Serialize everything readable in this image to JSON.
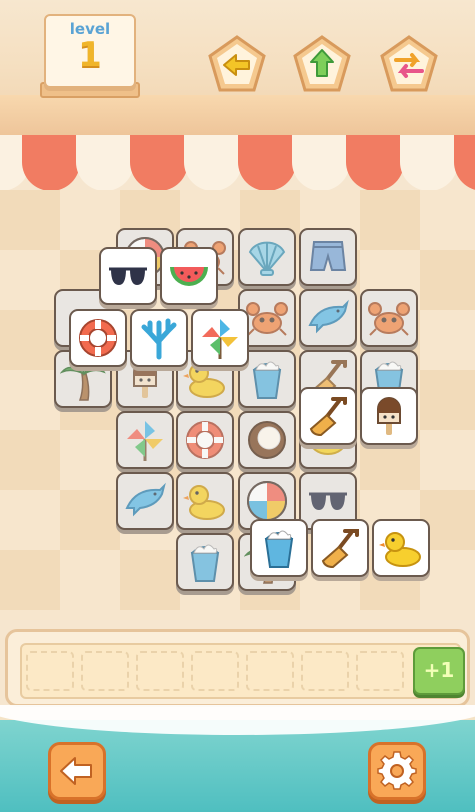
{
  "level": {
    "label": "level",
    "number": "1"
  },
  "toolbar": {
    "buttons": [
      {
        "name": "undo-button",
        "icon": "arrow-left-icon"
      },
      {
        "name": "hint-button",
        "icon": "arrow-up-icon"
      },
      {
        "name": "shuffle-button",
        "icon": "shuffle-icon"
      }
    ]
  },
  "tray": {
    "slots": 7,
    "plus_one_label": "+1"
  },
  "bottom": {
    "back_icon": "back-arrow-icon",
    "settings_icon": "gear-icon"
  },
  "colors": {
    "awning_red": "#f17c62",
    "button_orange": "#f9a857",
    "plus_green": "#8fcf5e"
  },
  "tiles": [
    "beach-ball",
    "crab",
    "seashell",
    "swim-shorts",
    "sunglasses",
    "watermelon",
    "crab",
    "dolphin",
    "crab",
    "life-ring",
    "coral",
    "pinwheel",
    "palm-tree",
    "ice-cream",
    "rubber-duck",
    "sand-bucket",
    "shovel",
    "sand-bucket",
    "shovel",
    "ice-cream",
    "pinwheel",
    "life-ring",
    "coconut",
    "lemon",
    "dolphin",
    "rubber-duck",
    "beach-ball",
    "sunglasses",
    "sand-bucket",
    "palm-tree",
    "sand-bucket",
    "shovel",
    "rubber-duck"
  ]
}
